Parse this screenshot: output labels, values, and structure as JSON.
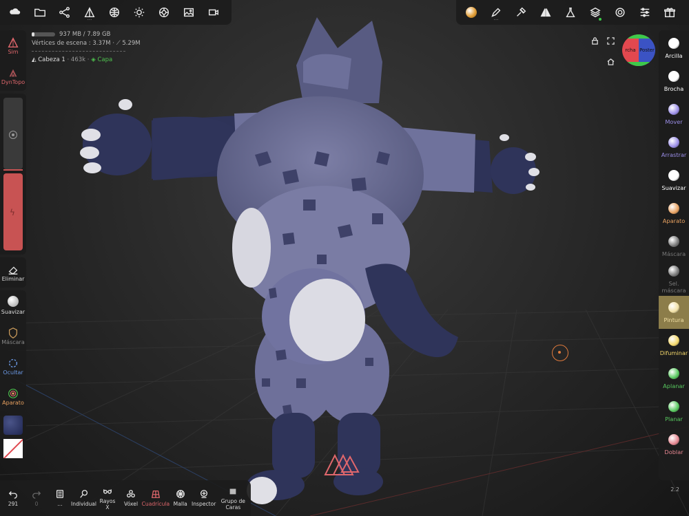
{
  "top_left_tools": [
    {
      "name": "cloud-icon"
    },
    {
      "name": "folder-icon"
    },
    {
      "name": "share-nodes-icon"
    },
    {
      "name": "camera-transform-icon"
    },
    {
      "name": "globe-grid-icon"
    },
    {
      "name": "sun-icon"
    },
    {
      "name": "material-ball-icon"
    },
    {
      "name": "image-icon"
    },
    {
      "name": "video-icon"
    }
  ],
  "top_right_tools": [
    {
      "name": "material-sphere-icon"
    },
    {
      "name": "pen-icon"
    },
    {
      "name": "picker-icon"
    },
    {
      "name": "symmetry-icon"
    },
    {
      "name": "flask-icon"
    },
    {
      "name": "layers-icon"
    },
    {
      "name": "settings-gear-icon"
    },
    {
      "name": "sliders-icon"
    },
    {
      "name": "gift-icon"
    }
  ],
  "info": {
    "memory": "937 MB / 7.89 GB",
    "scene_vertices": "Vértices de escena : 3.37M · ⟋ 5.29M",
    "mesh_name": "Cabeza 1",
    "mesh_count": "463k",
    "layer_label": "Capa"
  },
  "left_toolbar": {
    "sym_label": "Sim",
    "sym_sub": "L/R",
    "dyntopo_label": "DynTopo",
    "eliminar_label": "Eliminar",
    "suavizar_label": "Suavizar",
    "mascara_label": "Máscara",
    "ocultar_label": "Ocultar",
    "aparato_label": "Aparato"
  },
  "right_toolbar": {
    "items": [
      {
        "label": "Arcilla",
        "color": "#ffffff"
      },
      {
        "label": "Brocha",
        "color": "#ffffff"
      },
      {
        "label": "Mover",
        "color": "#9b8ee8"
      },
      {
        "label": "Arrastrar",
        "color": "#9b8ee8"
      },
      {
        "label": "Suavizar",
        "color": "#ffffff"
      },
      {
        "label": "Aparato",
        "color": "#e8a160"
      },
      {
        "label": "Máscara",
        "color": "#777777"
      },
      {
        "label": "Sel. máscara",
        "color": "#777777"
      },
      {
        "label": "Pintura",
        "color": "#f1e0a4"
      },
      {
        "label": "Difuminar",
        "color": "#f4d86b"
      },
      {
        "label": "Aplanar",
        "color": "#57c95e"
      },
      {
        "label": "Planar",
        "color": "#57c95e"
      },
      {
        "label": "Doblar",
        "color": "#e58690"
      }
    ],
    "version": "2.2"
  },
  "bottom_toolbar": {
    "undo_count": "291",
    "redo_count": "0",
    "more_label": "...",
    "items": [
      {
        "label": "Individual"
      },
      {
        "label": "Rayos X"
      },
      {
        "label": "Vóxel"
      },
      {
        "label": "Cuadrícula"
      },
      {
        "label": "Malla"
      },
      {
        "label": "Inspector"
      },
      {
        "label": "Grupo de Caras"
      }
    ]
  },
  "gizmo": {
    "left_label": "rcha",
    "right_label": "Poster"
  },
  "colors": {
    "accent_red": "#e0676c",
    "accent_green": "#4fc24f",
    "target": "#e07a3c",
    "active_tool": "#8c7d4a"
  }
}
